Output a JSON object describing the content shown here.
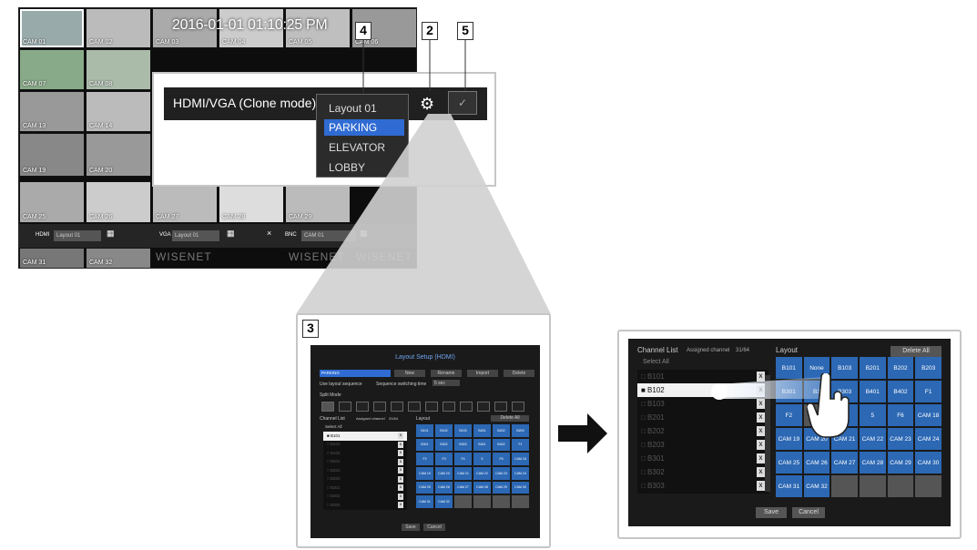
{
  "nvr": {
    "timestamp": "2016-01-01 01:10:25 PM",
    "cameras": [
      {
        "label": "CAM 01"
      },
      {
        "label": "CAM 02"
      },
      {
        "label": "CAM 03"
      },
      {
        "label": "CAM 04"
      },
      {
        "label": "CAM 05"
      },
      {
        "label": "CAM 06"
      },
      {
        "label": "CAM 07"
      },
      {
        "label": "CAM 08"
      },
      {
        "label": "CAM 13"
      },
      {
        "label": "CAM 14"
      },
      {
        "label": "CAM 19"
      },
      {
        "label": "CAM 20"
      },
      {
        "label": "CAM 25"
      },
      {
        "label": "CAM 26"
      },
      {
        "label": "CAM 27"
      },
      {
        "label": "CAM 28"
      },
      {
        "label": "CAM 29"
      },
      {
        "label": "CAM 31"
      },
      {
        "label": "CAM 32"
      }
    ],
    "brand_text": "WISENET",
    "bar": {
      "hdmi_label": "HDMI",
      "hdmi_value": "Layout 01",
      "vga_label": "VGA",
      "vga_value": "Layout 01",
      "bnc_label": "BNC",
      "bnc_value": "CAM 01"
    }
  },
  "zoom": {
    "title": "HDMI/VGA (Clone mode)",
    "dropdown": [
      "Layout 01",
      "PARKING",
      "ELEVATOR",
      "LOBBY"
    ],
    "selected_index": 1
  },
  "callouts": {
    "n2": "2",
    "n3": "3",
    "n4": "4",
    "n5": "5"
  },
  "layout_setup": {
    "title": "Layout Setup (HDMI)",
    "select_value": "PARKING",
    "buttons": [
      "New",
      "Rename",
      "Import",
      "Delete"
    ],
    "sequence_label": "Use layout sequence",
    "switch_label": "Sequence switching time",
    "switch_value": "5 sec",
    "split_label": "Split Mode",
    "channel_list": "Channel List",
    "assigned_label": "Assigned channel",
    "assigned_value": "31/64",
    "layout_label": "Layout",
    "delete_all": "Delete All",
    "select_all": "Select All",
    "channels": [
      "B101",
      "B102",
      "B103",
      "B201",
      "B202",
      "B203",
      "B301",
      "B302",
      "B303"
    ],
    "cells": [
      "B101",
      "B102",
      "B103",
      "B201",
      "B202",
      "B203",
      "B301",
      "B302",
      "B303",
      "B401",
      "B402",
      "F1",
      "F2",
      "F3",
      "F4",
      "5",
      "F6",
      "CAM 18",
      "CAM 19",
      "CAM 20",
      "CAM 21",
      "CAM 22",
      "CAM 23",
      "CAM 24",
      "CAM 25",
      "CAM 26",
      "CAM 27",
      "CAM 28",
      "CAM 29",
      "CAM 30",
      "CAM 31",
      "CAM 32",
      "",
      "",
      "",
      ""
    ],
    "save": "Save",
    "cancel": "Cancel"
  },
  "detail": {
    "channel_list": "Channel List",
    "assigned_label": "Assigned channel",
    "assigned_value": "31/64",
    "layout_label": "Layout",
    "delete_all": "Delete All",
    "select_all": "Select All",
    "channels": [
      "B101",
      "B102",
      "B103",
      "B201",
      "B202",
      "B203",
      "B301",
      "B302",
      "B303"
    ],
    "selected_channel_index": 1,
    "cells": [
      "B101",
      "None",
      "B103",
      "B201",
      "B202",
      "B203",
      "B301",
      "B3",
      "B303",
      "B401",
      "B402",
      "F1",
      "F2",
      "",
      "F4",
      "5",
      "F6",
      "CAM 18",
      "CAM 19",
      "CAM 20",
      "CAM 21",
      "CAM 22",
      "CAM 23",
      "CAM 24",
      "CAM 25",
      "CAM 26",
      "CAM 27",
      "CAM 28",
      "CAM 29",
      "CAM 30",
      "CAM 31",
      "CAM 32",
      "",
      "",
      "",
      ""
    ],
    "save": "Save",
    "cancel": "Cancel"
  },
  "colors": {
    "accent": "#2f6bd2",
    "cell": "#2c68b4",
    "panel_bg": "#1a1a1a"
  }
}
